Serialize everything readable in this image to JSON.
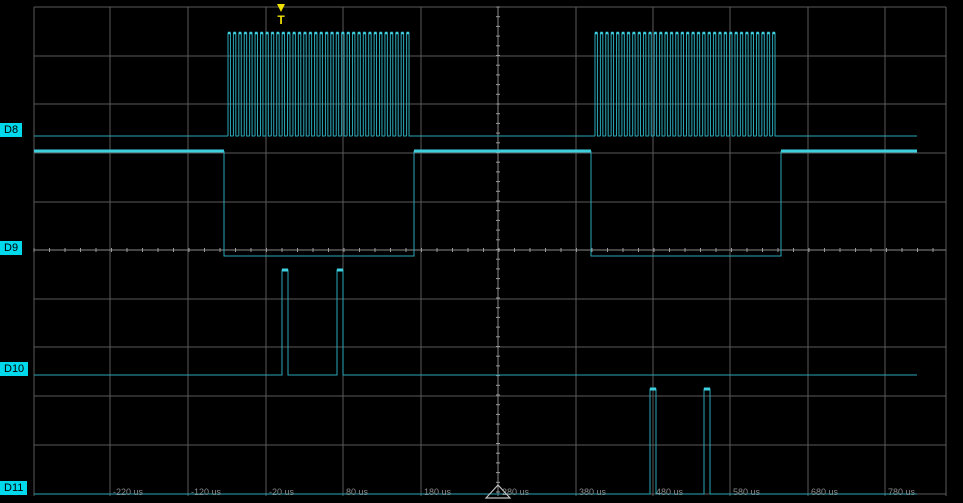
{
  "channels": [
    {
      "label": "D8"
    },
    {
      "label": "D9"
    },
    {
      "label": "D10"
    },
    {
      "label": "D11"
    }
  ],
  "trigger": {
    "label": "T"
  },
  "time_axis": {
    "unit": "us",
    "tick_labels": [
      "-220 us",
      "-120 us",
      "-20 us",
      "80 us",
      "180 us",
      "280 us",
      "380 us",
      "480 us",
      "580 us",
      "680 us",
      "780 us"
    ]
  },
  "colors": {
    "background": "#000000",
    "grid": "#5a5a5a",
    "trace": "#3fd0e0",
    "trace_dim": "#2aa8b8",
    "label_bg": "#00d8ec",
    "trigger": "#f0e000",
    "axis_text": "#8a8a8a"
  }
}
